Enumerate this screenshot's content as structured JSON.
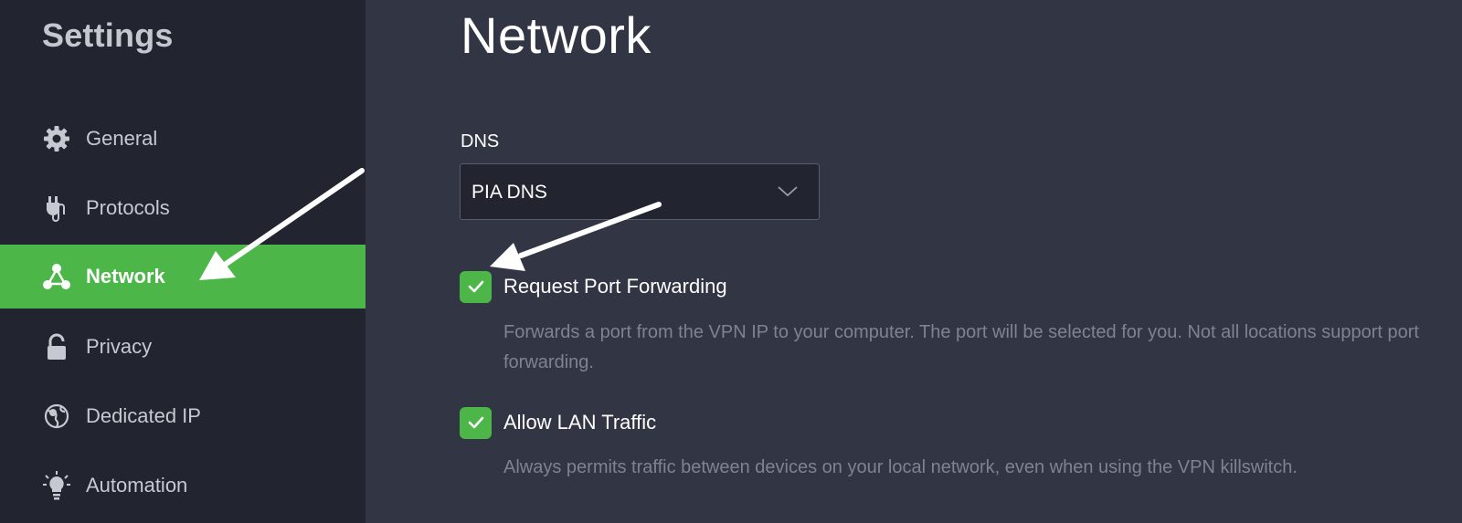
{
  "sidebar": {
    "title": "Settings",
    "items": [
      {
        "label": "General",
        "icon": "gear-icon",
        "active": false
      },
      {
        "label": "Protocols",
        "icon": "plug-icon",
        "active": false
      },
      {
        "label": "Network",
        "icon": "network-icon",
        "active": true
      },
      {
        "label": "Privacy",
        "icon": "lock-icon",
        "active": false
      },
      {
        "label": "Dedicated IP",
        "icon": "globe-icon",
        "active": false
      },
      {
        "label": "Automation",
        "icon": "lightbulb-icon",
        "active": false
      }
    ]
  },
  "main": {
    "title": "Network",
    "dns": {
      "label": "DNS",
      "selected": "PIA DNS"
    },
    "options": [
      {
        "label": "Request Port Forwarding",
        "checked": true,
        "description": "Forwards a port from the VPN IP to your computer. The port will be selected for you. Not all locations support port forwarding."
      },
      {
        "label": "Allow LAN Traffic",
        "checked": true,
        "description": "Always permits traffic between devices on your local network, even when using the VPN killswitch."
      }
    ]
  },
  "colors": {
    "sidebar_bg": "#222530",
    "main_bg": "#323544",
    "accent": "#4cb649",
    "muted_text": "#7f8391"
  }
}
